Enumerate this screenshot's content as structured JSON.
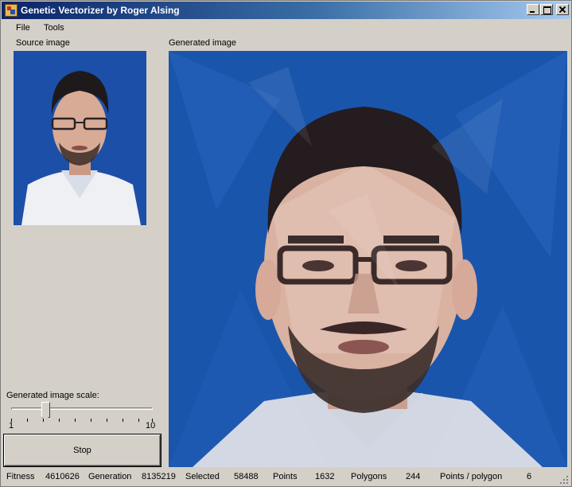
{
  "window": {
    "title": "Genetic Vectorizer by Roger Alsing"
  },
  "menu": {
    "file": "File",
    "tools": "Tools"
  },
  "panels": {
    "source_label": "Source image",
    "generated_label": "Generated image"
  },
  "scale": {
    "label": "Generated image scale:",
    "min": "1",
    "max": "10",
    "value_fraction": 0.25
  },
  "stop_button": "Stop",
  "status": {
    "fitness_label": "Fitness",
    "fitness": "4610626",
    "generation_label": "Generation",
    "generation": "8135219",
    "selected_label": "Selected",
    "selected": "58488",
    "points_label": "Points",
    "points": "1632",
    "polygons_label": "Polygons",
    "polygons": "244",
    "ppp_label": "Points / polygon",
    "ppp": "6"
  },
  "colors": {
    "titlebar_start": "#0a246a",
    "titlebar_end": "#a6caf0",
    "chrome": "#d4d0c8",
    "photo_background": "#1a4ea8"
  },
  "icons": [
    "app-icon",
    "minimize-icon",
    "maximize-icon",
    "close-icon",
    "size-grip-icon"
  ]
}
